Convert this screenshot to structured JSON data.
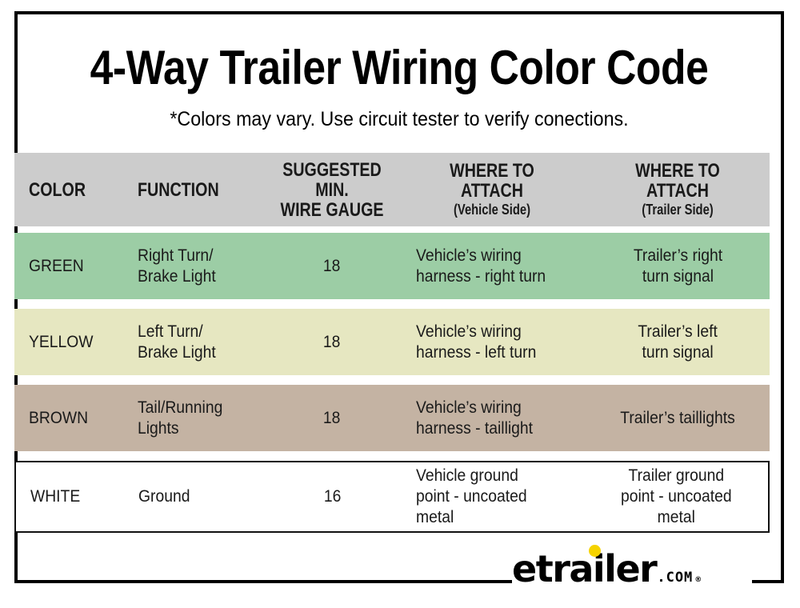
{
  "header": {
    "title": "4-Way Trailer Wiring Color Code",
    "subtitle": "*Colors may vary. Use circuit tester to verify conections."
  },
  "table": {
    "columns": [
      {
        "label": "COLOR",
        "sub": ""
      },
      {
        "label": "FUNCTION",
        "sub": ""
      },
      {
        "label": "SUGGESTED MIN. WIRE GAUGE",
        "line1": "SUGGESTED MIN.",
        "line2": "WIRE GAUGE",
        "sub": ""
      },
      {
        "label": "WHERE TO ATTACH",
        "sub": "(Vehicle Side)"
      },
      {
        "label": "WHERE TO ATTACH",
        "sub": "(Trailer Side)"
      }
    ],
    "rows": [
      {
        "color": "GREEN",
        "function": "Right Turn/ Brake Light",
        "function_line1": "Right Turn/",
        "function_line2": "Brake Light",
        "gauge": "18",
        "vehicle": "Vehicle’s wiring harness - right turn",
        "vehicle_line1": "Vehicle’s wiring",
        "vehicle_line2": "harness - right turn",
        "trailer": "Trailer’s right turn signal",
        "trailer_line1": "Trailer’s right",
        "trailer_line2": "turn signal",
        "fill_hex": "#9CCDA5"
      },
      {
        "color": "YELLOW",
        "function": "Left Turn/ Brake Light",
        "function_line1": "Left Turn/",
        "function_line2": "Brake Light",
        "gauge": "18",
        "vehicle": "Vehicle’s wiring harness - left turn",
        "vehicle_line1": "Vehicle’s wiring",
        "vehicle_line2": "harness - left turn",
        "trailer": "Trailer’s left turn signal",
        "trailer_line1": "Trailer’s left",
        "trailer_line2": "turn signal",
        "fill_hex": "#E6E7C1"
      },
      {
        "color": "BROWN",
        "function": "Tail/Running Lights",
        "function_line1": "Tail/Running",
        "function_line2": "Lights",
        "gauge": "18",
        "vehicle": "Vehicle’s wiring harness - taillight",
        "vehicle_line1": "Vehicle’s wiring",
        "vehicle_line2": "harness - taillight",
        "trailer": "Trailer’s taillights",
        "trailer_line1": "Trailer’s taillights",
        "trailer_line2": "",
        "fill_hex": "#C4B3A3"
      },
      {
        "color": "WHITE",
        "function": "Ground",
        "function_line1": "Ground",
        "function_line2": "",
        "gauge": "16",
        "vehicle": "Vehicle ground point - uncoated metal",
        "vehicle_line1": "Vehicle ground",
        "vehicle_line2": "point - uncoated",
        "vehicle_line3": "metal",
        "trailer": "Trailer ground point - uncoated metal",
        "trailer_line1": "Trailer ground",
        "trailer_line2": "point - uncoated",
        "trailer_line3": "metal",
        "fill_hex": "#FFFFFF"
      }
    ]
  },
  "logo": {
    "name": "etrailer",
    "tld": ".COM",
    "registered": "®",
    "dot_hex": "#F5D300"
  },
  "colors": {
    "header_fill": "#CCCCCC",
    "frame": "#000000",
    "background": "#FFFFFF"
  }
}
